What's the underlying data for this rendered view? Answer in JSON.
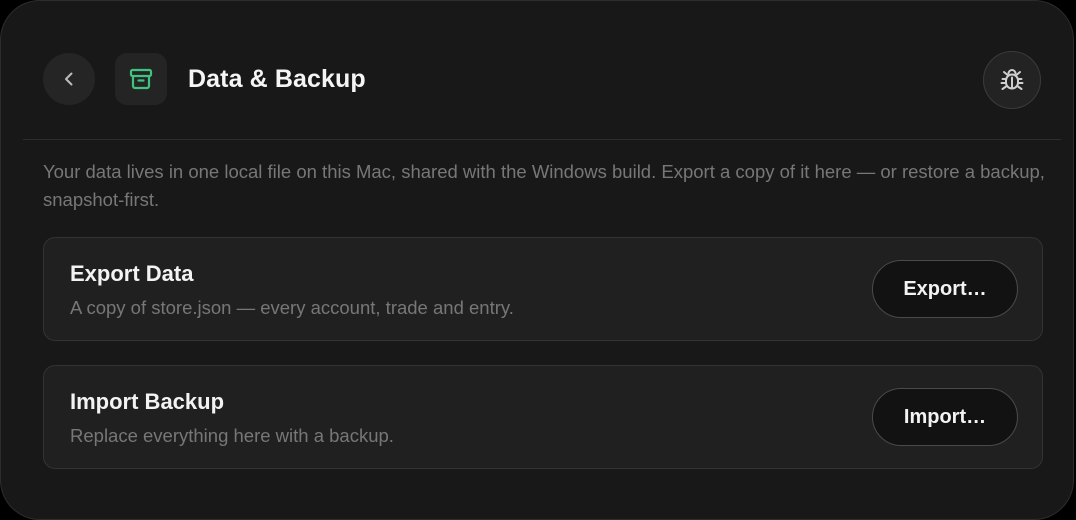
{
  "header": {
    "back_icon": "chevron-left-icon",
    "section_icon": "archive-box-icon",
    "title": "Data & Backup",
    "debug_icon": "bug-icon"
  },
  "intro": {
    "text": "Your data lives in one local file on this Mac, shared with the Windows build. Export a copy of it here — or restore a backup, snapshot-first."
  },
  "cards": [
    {
      "title": "Export Data",
      "description": "A copy of store.json — every account, trade and entry.",
      "button_label": "Export…"
    },
    {
      "title": "Import Backup",
      "description": "Replace everything here with a backup.",
      "button_label": "Import…"
    }
  ],
  "colors": {
    "accent": "#3ec47e",
    "panel_background": "#181818",
    "card_background": "#202020",
    "muted_text": "#777777"
  }
}
